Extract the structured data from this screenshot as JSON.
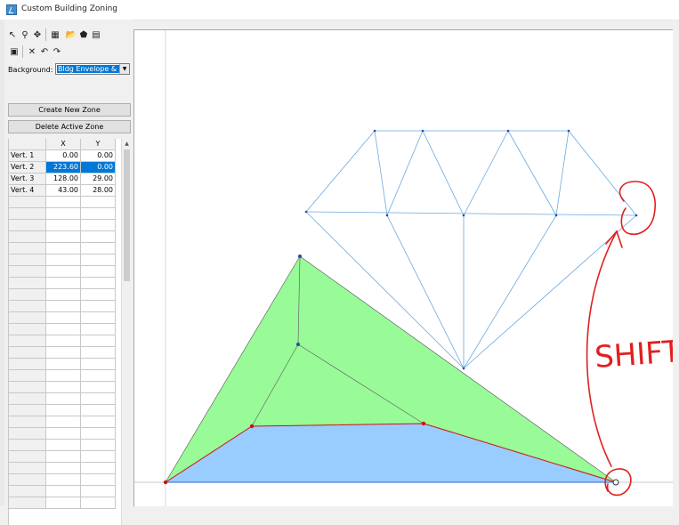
{
  "window": {
    "title": "Custom Building Zoning"
  },
  "toolbar": {
    "row1": [
      {
        "name": "select-arrow-icon",
        "glyph": "↖"
      },
      {
        "name": "zoom-icon",
        "glyph": "⚲"
      },
      {
        "name": "pan-icon",
        "glyph": "✥"
      },
      {
        "name": "grid-icon",
        "glyph": "▦"
      },
      {
        "name": "open-folder-icon",
        "glyph": "📂"
      },
      {
        "name": "shape-icon",
        "glyph": "⬟"
      },
      {
        "name": "layers-icon",
        "glyph": "▤"
      }
    ],
    "row2": [
      {
        "name": "save-icon",
        "glyph": "▣"
      },
      {
        "name": "delete-icon",
        "glyph": "✕"
      },
      {
        "name": "undo-icon",
        "glyph": "↶"
      },
      {
        "name": "redo-icon",
        "glyph": "↷"
      }
    ]
  },
  "background": {
    "label": "Background:",
    "value": "Bldg Envelope & Lo"
  },
  "buttons": {
    "create_zone": "Create New Zone",
    "delete_zone": "Delete Active Zone"
  },
  "grid": {
    "headers": [
      "",
      "X",
      "Y"
    ],
    "rows": [
      {
        "label": "Vert. 1",
        "x": "0.00",
        "y": "0.00"
      },
      {
        "label": "Vert. 2",
        "x": "223.60",
        "y": "0.00"
      },
      {
        "label": "Vert. 3",
        "x": "128.00",
        "y": "29.00"
      },
      {
        "label": "Vert. 4",
        "x": "43.00",
        "y": "28.00"
      }
    ],
    "selected_row": 1,
    "blank_rows": 27
  },
  "annotation": {
    "text": "SHIFT",
    "color": "#e02020"
  },
  "colors": {
    "zone_green": "#98fb98",
    "zone_blue": "#99ccff",
    "diamond_line": "#6aa8e0",
    "selected_edge": "#d01010"
  }
}
